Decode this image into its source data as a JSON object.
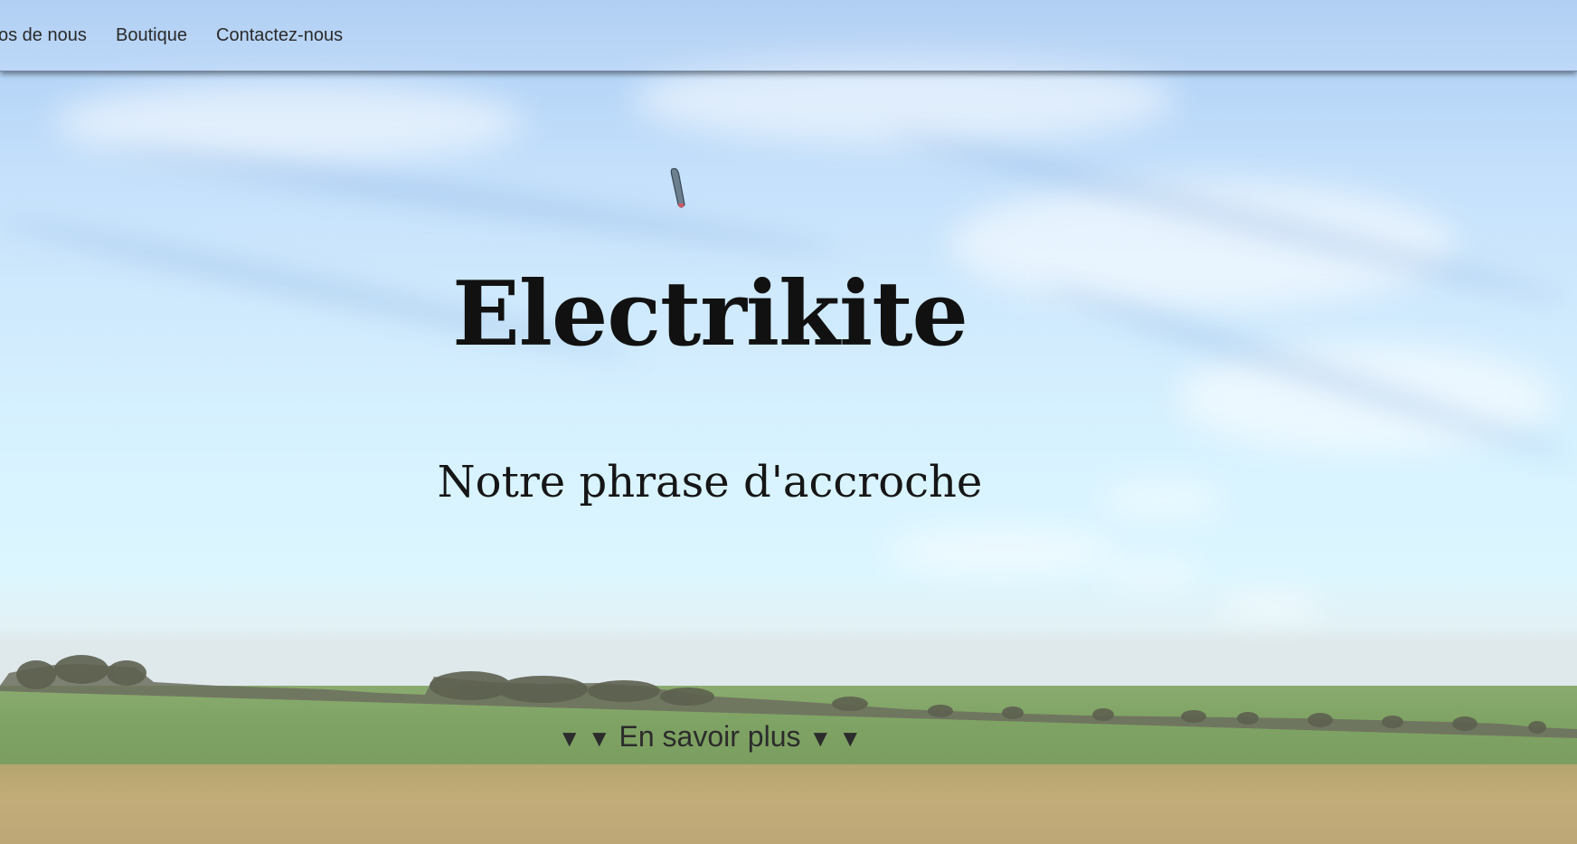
{
  "nav": {
    "items": [
      {
        "label": "os de nous"
      },
      {
        "label": "Boutique"
      },
      {
        "label": "Contactez-nous"
      }
    ]
  },
  "hero": {
    "title": "Electrikite",
    "tagline": "Notre phrase d'accroche",
    "learn_more": {
      "arrows_left": "▼ ▼",
      "label": "En savoir plus",
      "arrows_right": "▼ ▼"
    }
  },
  "colors": {
    "sky_top": "#9fc3ef",
    "sky_bottom": "#dcf6ff",
    "field_green": "#84a86a",
    "field_straw": "#b9a672",
    "text_dark": "#111111"
  },
  "icons": {
    "learn_more_arrow": "triangle-down-icon",
    "kite": "kite-icon"
  }
}
